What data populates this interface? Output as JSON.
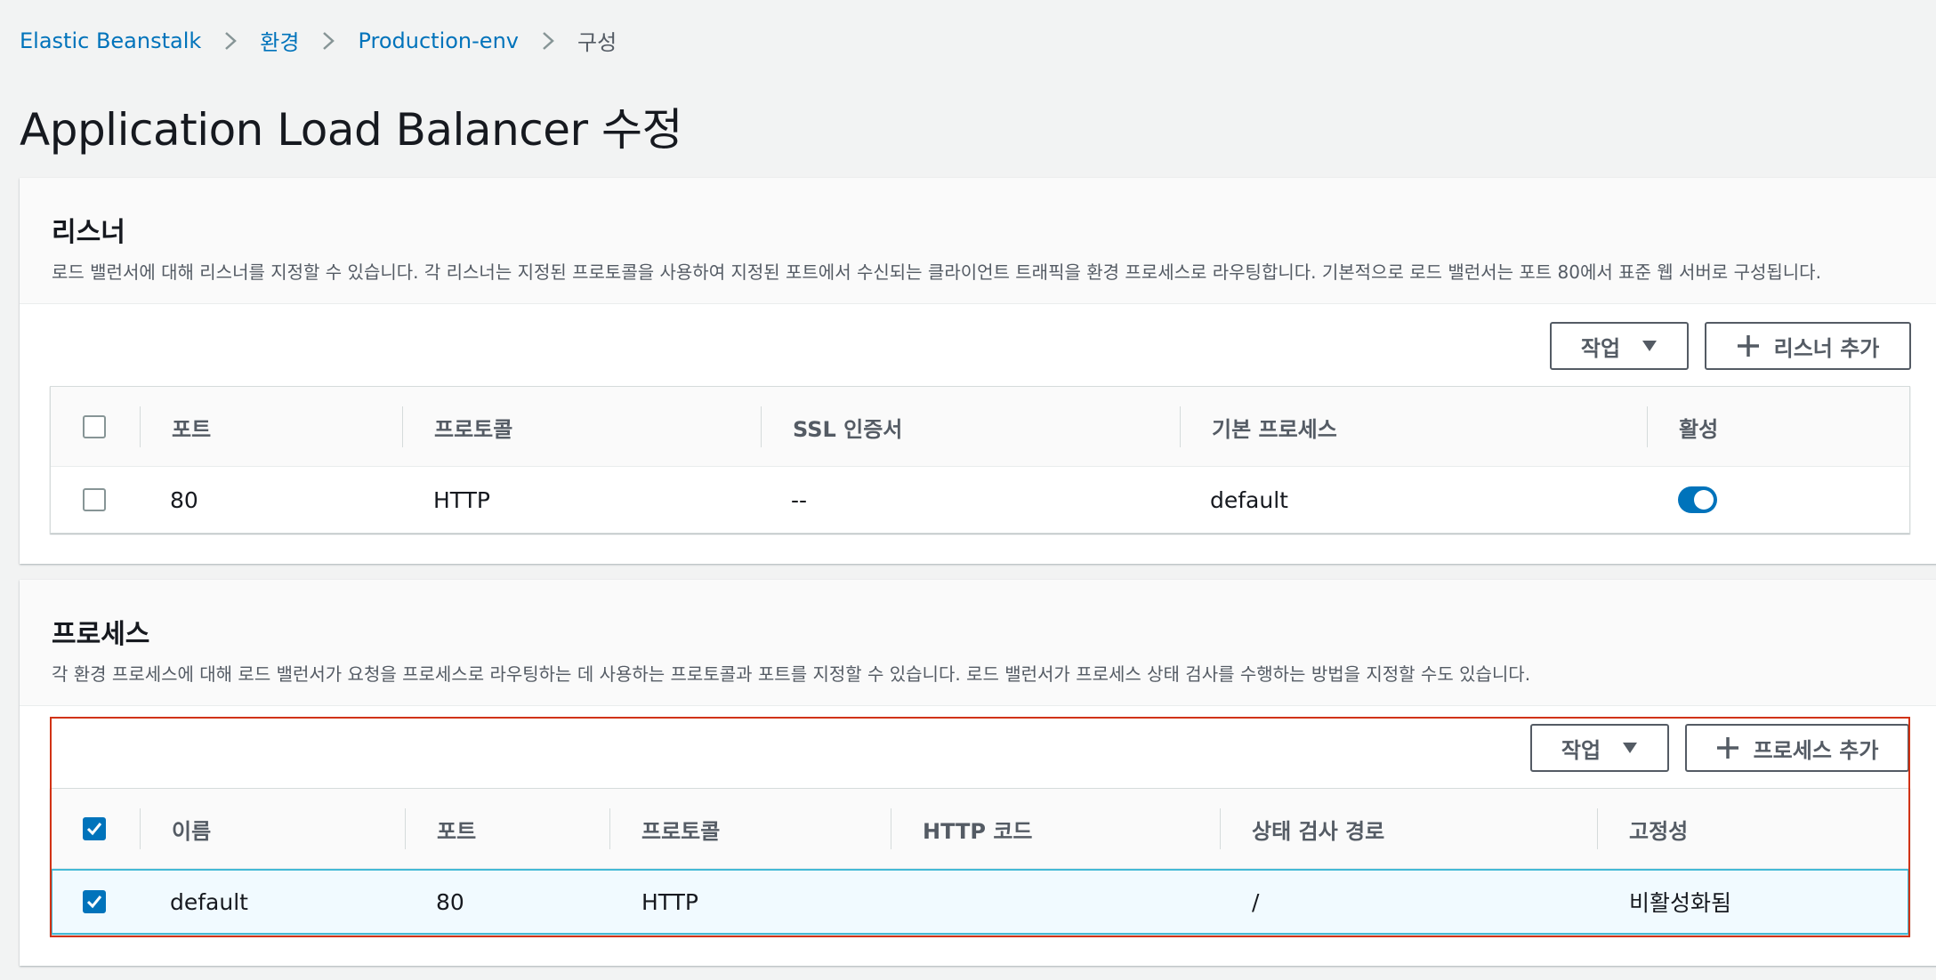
{
  "breadcrumb": {
    "items": [
      "Elastic Beanstalk",
      "환경",
      "Production-env"
    ],
    "current": "구성"
  },
  "page_title": "Application Load Balancer 수정",
  "listeners": {
    "title": "리스너",
    "description": "로드 밸런서에 대해 리스너를 지정할 수 있습니다. 각 리스너는 지정된 프로토콜을 사용하여 지정된 포트에서 수신되는 클라이언트 트래픽을 환경 프로세스로 라우팅합니다. 기본적으로 로드 밸런서는 포트 80에서 표준 웹 서버로 구성됩니다.",
    "actions_label": "작업",
    "add_label": "리스너 추가",
    "columns": [
      "포트",
      "프로토콜",
      "SSL 인증서",
      "기본 프로세스",
      "활성"
    ],
    "rows": [
      {
        "port": "80",
        "protocol": "HTTP",
        "ssl": "--",
        "process": "default",
        "enabled": true,
        "selected": false
      }
    ]
  },
  "processes": {
    "title": "프로세스",
    "description": "각 환경 프로세스에 대해 로드 밸런서가 요청을 프로세스로 라우팅하는 데 사용하는 프로토콜과 포트를 지정할 수 있습니다. 로드 밸런서가 프로세스 상태 검사를 수행하는 방법을 지정할 수도 있습니다.",
    "actions_label": "작업",
    "add_label": "프로세스 추가",
    "columns": [
      "이름",
      "포트",
      "프로토콜",
      "HTTP 코드",
      "상태 검사 경로",
      "고정성"
    ],
    "rows": [
      {
        "name": "default",
        "port": "80",
        "protocol": "HTTP",
        "http_code": "",
        "health_path": "/",
        "stickiness": "비활성화됨",
        "selected": true
      }
    ]
  },
  "colors": {
    "link": "#0073bb",
    "accent": "#0073bb",
    "highlight": "#d13212",
    "selected_row": "#f1faff"
  }
}
